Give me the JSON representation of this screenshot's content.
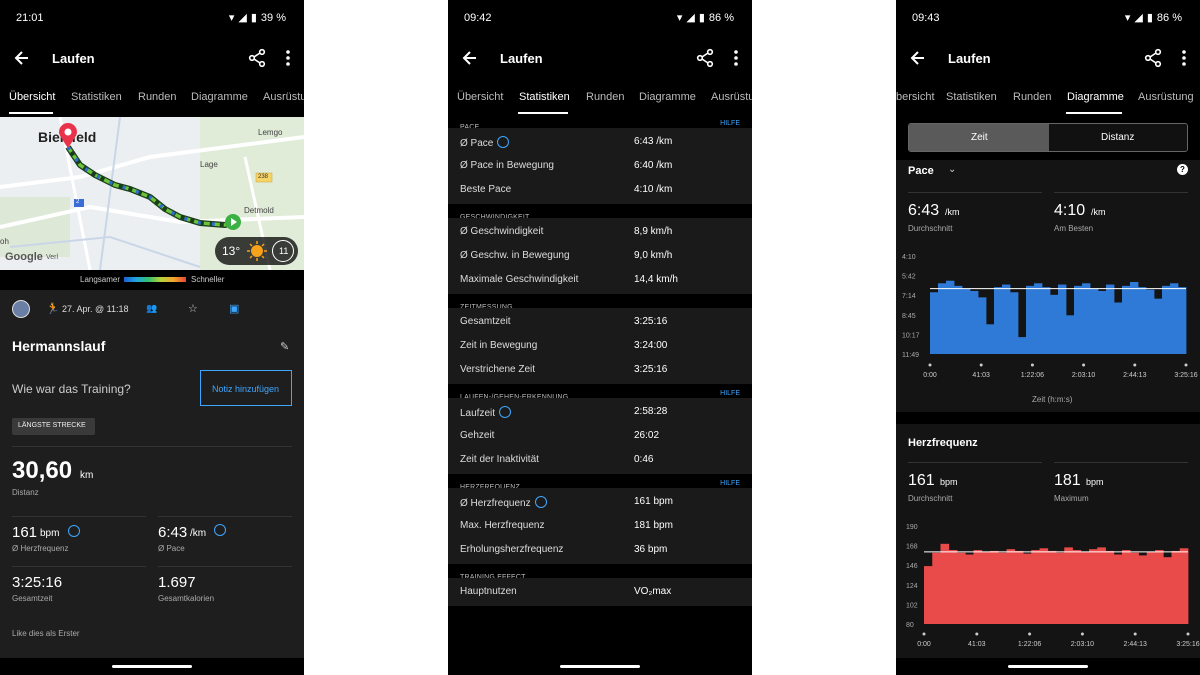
{
  "screens": [
    {
      "status": {
        "time": "21:01",
        "battery": "39 %"
      },
      "appbar": {
        "title": "Laufen"
      },
      "tabs": [
        "Übersicht",
        "Statistiken",
        "Runden",
        "Diagramme",
        "Ausrüstu"
      ],
      "map": {
        "city1": "Bielefeld",
        "city2": "Lemgo",
        "city3": "Lage",
        "city4": "Detmold",
        "road1": "238",
        "road2": "2",
        "google": "Google",
        "verl": "Verl",
        "oh": "oh",
        "temp": "13°",
        "wind": "11"
      },
      "legend": {
        "slow": "Langsamer",
        "fast": "Schneller"
      },
      "meta": {
        "date": "27. Apr. @ 11:18"
      },
      "activity": {
        "name": "Hermannslauf",
        "prompt": "Wie war das Training?",
        "note_button": "Notiz hinzufügen",
        "badge": "LÄNGSTE STRECKE"
      },
      "distance": {
        "value": "30,60",
        "unit": "km",
        "label": "Distanz"
      },
      "stats": [
        {
          "value": "161",
          "unit": "bpm",
          "label": "Ø Herzfrequenz"
        },
        {
          "value": "6:43",
          "unit": "/km",
          "label": "Ø Pace"
        },
        {
          "value": "3:25:16",
          "unit": "",
          "label": "Gesamtzeit"
        },
        {
          "value": "1.697",
          "unit": "",
          "label": "Gesamtkalorien"
        }
      ],
      "like": "Like dies als Erster"
    },
    {
      "status": {
        "time": "09:42",
        "battery": "86 %"
      },
      "appbar": {
        "title": "Laufen"
      },
      "tabs": [
        "Übersicht",
        "Statistiken",
        "Runden",
        "Diagramme",
        "Ausrüstu"
      ],
      "sections": [
        {
          "header": "PACE",
          "hilfe": "HILFE",
          "rows": [
            [
              "Ø Pace",
              "6:43 /km"
            ],
            [
              "Ø Pace in Bewegung",
              "6:40 /km"
            ],
            [
              "Beste Pace",
              "4:10 /km"
            ]
          ]
        },
        {
          "header": "GESCHWINDIGKEIT",
          "hilfe": "",
          "rows": [
            [
              "Ø Geschwindigkeit",
              "8,9 km/h"
            ],
            [
              "Ø Geschw. in Bewegung",
              "9,0 km/h"
            ],
            [
              "Maximale Geschwindigkeit",
              "14,4 km/h"
            ]
          ]
        },
        {
          "header": "ZEITMESSUNG",
          "hilfe": "",
          "rows": [
            [
              "Gesamtzeit",
              "3:25:16"
            ],
            [
              "Zeit in Bewegung",
              "3:24:00"
            ],
            [
              "Verstrichene Zeit",
              "3:25:16"
            ]
          ]
        },
        {
          "header": "LAUFEN-/GEHEN-ERKENNUNG",
          "hilfe": "HILFE",
          "rows": [
            [
              "Laufzeit",
              "2:58:28"
            ],
            [
              "Gehzeit",
              "26:02"
            ],
            [
              "Zeit der Inaktivität",
              "0:46"
            ]
          ]
        },
        {
          "header": "HERZFREQUENZ",
          "hilfe": "HILFE",
          "rows": [
            [
              "Ø Herzfrequenz",
              "161 bpm"
            ],
            [
              "Max. Herzfrequenz",
              "181 bpm"
            ],
            [
              "Erholungsherzfrequenz",
              "36 bpm"
            ]
          ]
        },
        {
          "header": "TRAINING EFFECT",
          "hilfe": "",
          "rows": [
            [
              "Hauptnutzen",
              "VO₂max"
            ]
          ]
        }
      ]
    },
    {
      "status": {
        "time": "09:43",
        "battery": "86 %"
      },
      "appbar": {
        "title": "Laufen"
      },
      "tabs": [
        "bersicht",
        "Statistiken",
        "Runden",
        "Diagramme",
        "Ausrüstung"
      ],
      "toggle": {
        "left": "Zeit",
        "right": "Distanz"
      },
      "pace": {
        "title": "Pace",
        "avg": "6:43",
        "avg_unit": "/km",
        "avg_label": "Durchschnitt",
        "best": "4:10",
        "best_unit": "/km",
        "best_label": "Am Besten",
        "axis_title": "Zeit (h:m:s)"
      },
      "hr": {
        "title": "Herzfrequenz",
        "avg": "161",
        "avg_unit": "bpm",
        "avg_label": "Durchschnitt",
        "max": "181",
        "max_unit": "bpm",
        "max_label": "Maximum"
      },
      "colors": {
        "pace_fill": "#2f7ad6",
        "hr_fill": "#e94a4a",
        "accent": "#3ea6ff"
      }
    }
  ],
  "chart_data": [
    {
      "type": "area",
      "title": "Pace",
      "xlabel": "Zeit (h:m:s)",
      "ylabel": "",
      "x_ticks": [
        "0:00",
        "41:03",
        "1:22:06",
        "2:03:10",
        "2:44:13",
        "3:25:16"
      ],
      "y_ticks": [
        "4:10",
        "5:42",
        "7:14",
        "8:45",
        "10:17",
        "11:49"
      ],
      "ylim_min_per_km": [
        4.17,
        11.82
      ],
      "y_inverted": true,
      "average_line": "6:43",
      "series": [
        {
          "values_min_per_km": [
            7.0,
            6.3,
            6.1,
            6.5,
            6.7,
            6.9,
            7.4,
            9.5,
            6.6,
            6.4,
            7.0,
            10.5,
            6.5,
            6.3,
            6.6,
            7.2,
            6.4,
            8.8,
            6.5,
            6.3,
            6.7,
            6.9,
            6.4,
            7.8,
            6.5,
            6.2,
            6.6,
            6.8,
            7.5,
            6.5,
            6.3,
            6.6
          ]
        }
      ]
    },
    {
      "type": "area",
      "title": "Herzfrequenz",
      "xlabel": "",
      "ylabel": "",
      "x_ticks": [
        "0:00",
        "41:03",
        "1:22:06",
        "2:03:10",
        "2:44:13",
        "3:25:16"
      ],
      "y_ticks": [
        "190",
        "168",
        "146",
        "124",
        "102",
        "80"
      ],
      "ylim": [
        80,
        190
      ],
      "average_line": 161,
      "series": [
        {
          "values": [
            145,
            160,
            170,
            163,
            160,
            158,
            163,
            161,
            162,
            160,
            164,
            162,
            159,
            163,
            165,
            162,
            160,
            166,
            163,
            161,
            164,
            166,
            162,
            158,
            163,
            160,
            157,
            161,
            163,
            155,
            162,
            165
          ]
        }
      ]
    }
  ]
}
